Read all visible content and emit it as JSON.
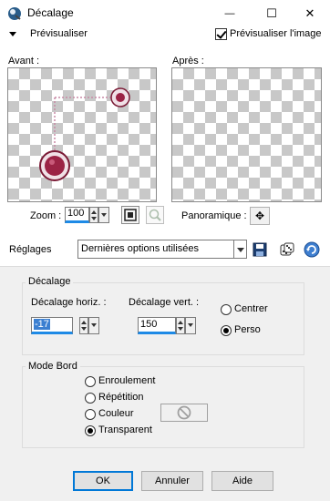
{
  "window": {
    "title": "Décalage",
    "icon": "app-icon",
    "minimize_glyph": "—",
    "maximize_glyph": "☐",
    "close_glyph": "✕"
  },
  "preview": {
    "toggle_label": "Prévisualiser",
    "preview_image_label": "Prévisualiser l'image",
    "preview_image_checked": true,
    "before_label": "Avant :",
    "after_label": "Après :"
  },
  "zoom": {
    "label": "Zoom :",
    "value": "100",
    "pan_label": "Panoramique :",
    "pan_glyph": "✥"
  },
  "presets": {
    "label": "Réglages",
    "value": "Dernières options utilisées"
  },
  "offset": {
    "group_title": "Décalage",
    "horizontal_label": "Décalage horiz. :",
    "horizontal_value": "-17",
    "vertical_label": "Décalage vert. :",
    "vertical_value": "150",
    "options": [
      {
        "label": "Centrer",
        "selected": false
      },
      {
        "label": "Perso",
        "selected": true
      }
    ]
  },
  "edge_mode": {
    "group_title": "Mode Bord",
    "options": [
      {
        "label": "Enroulement",
        "selected": false
      },
      {
        "label": "Répétition",
        "selected": false
      },
      {
        "label": "Couleur",
        "selected": false
      },
      {
        "label": "Transparent",
        "selected": true
      }
    ]
  },
  "buttons": {
    "ok": "OK",
    "cancel": "Annuler",
    "help": "Aide"
  },
  "colors": {
    "accent": "#1e8ae6",
    "marker": "#9b2345",
    "dotted_line": "#c88aa6"
  }
}
